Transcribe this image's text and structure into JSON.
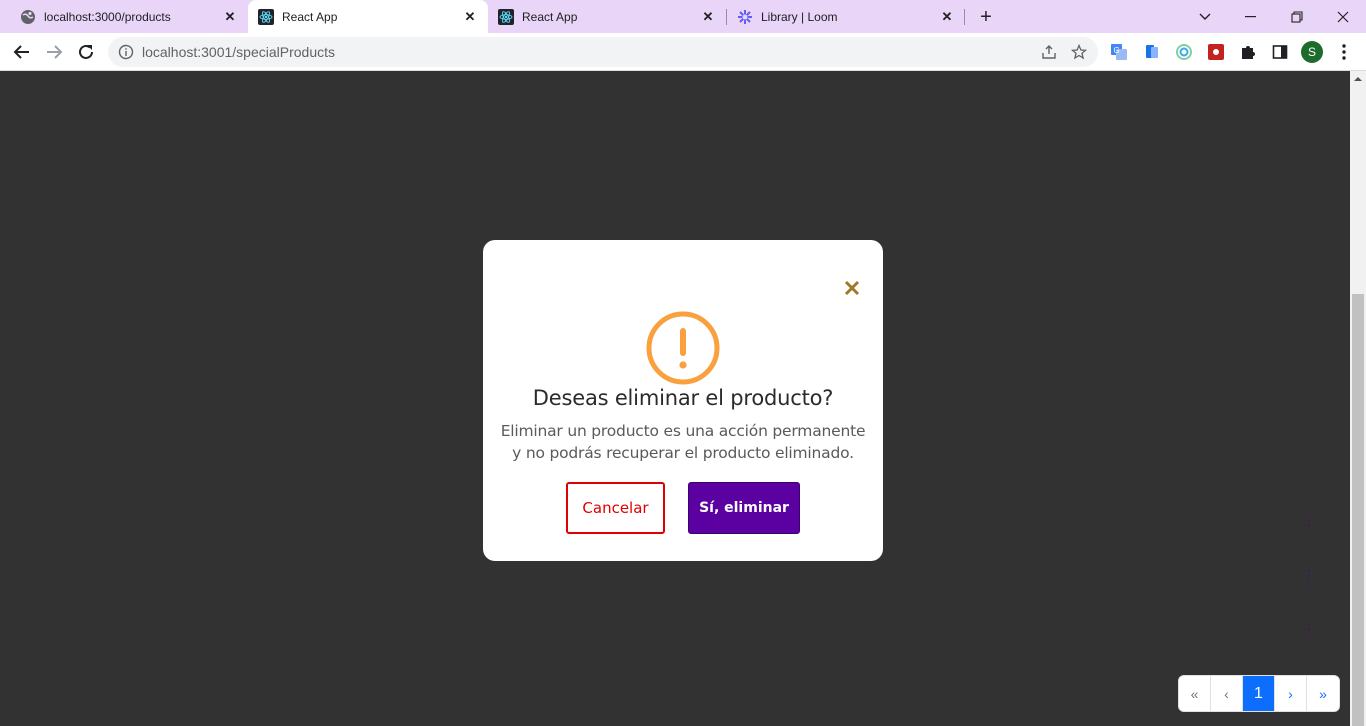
{
  "browser": {
    "tabs": [
      {
        "title": "localhost:3000/products",
        "active": false
      },
      {
        "title": "React App",
        "active": true
      },
      {
        "title": "React App",
        "active": false
      },
      {
        "title": "Library | Loom",
        "active": false
      }
    ],
    "url": "localhost:3001/specialProducts",
    "profile_initial": "S"
  },
  "modal": {
    "title": "Deseas eliminar el producto?",
    "message_line1": "Eliminar un producto es una acción permanente",
    "message_line2": "y no podrás recuperar el producto eliminado.",
    "cancel_label": "Cancelar",
    "confirm_label": "Sí, eliminar"
  },
  "pagination": {
    "first": "«",
    "prev": "‹",
    "current": "1",
    "next": "›",
    "last": "»"
  },
  "colors": {
    "warning": "#f9a03f",
    "cancel": "#e00000",
    "confirm": "#5b00a1",
    "page_active": "#0d6efd",
    "close": "#a0782a"
  }
}
